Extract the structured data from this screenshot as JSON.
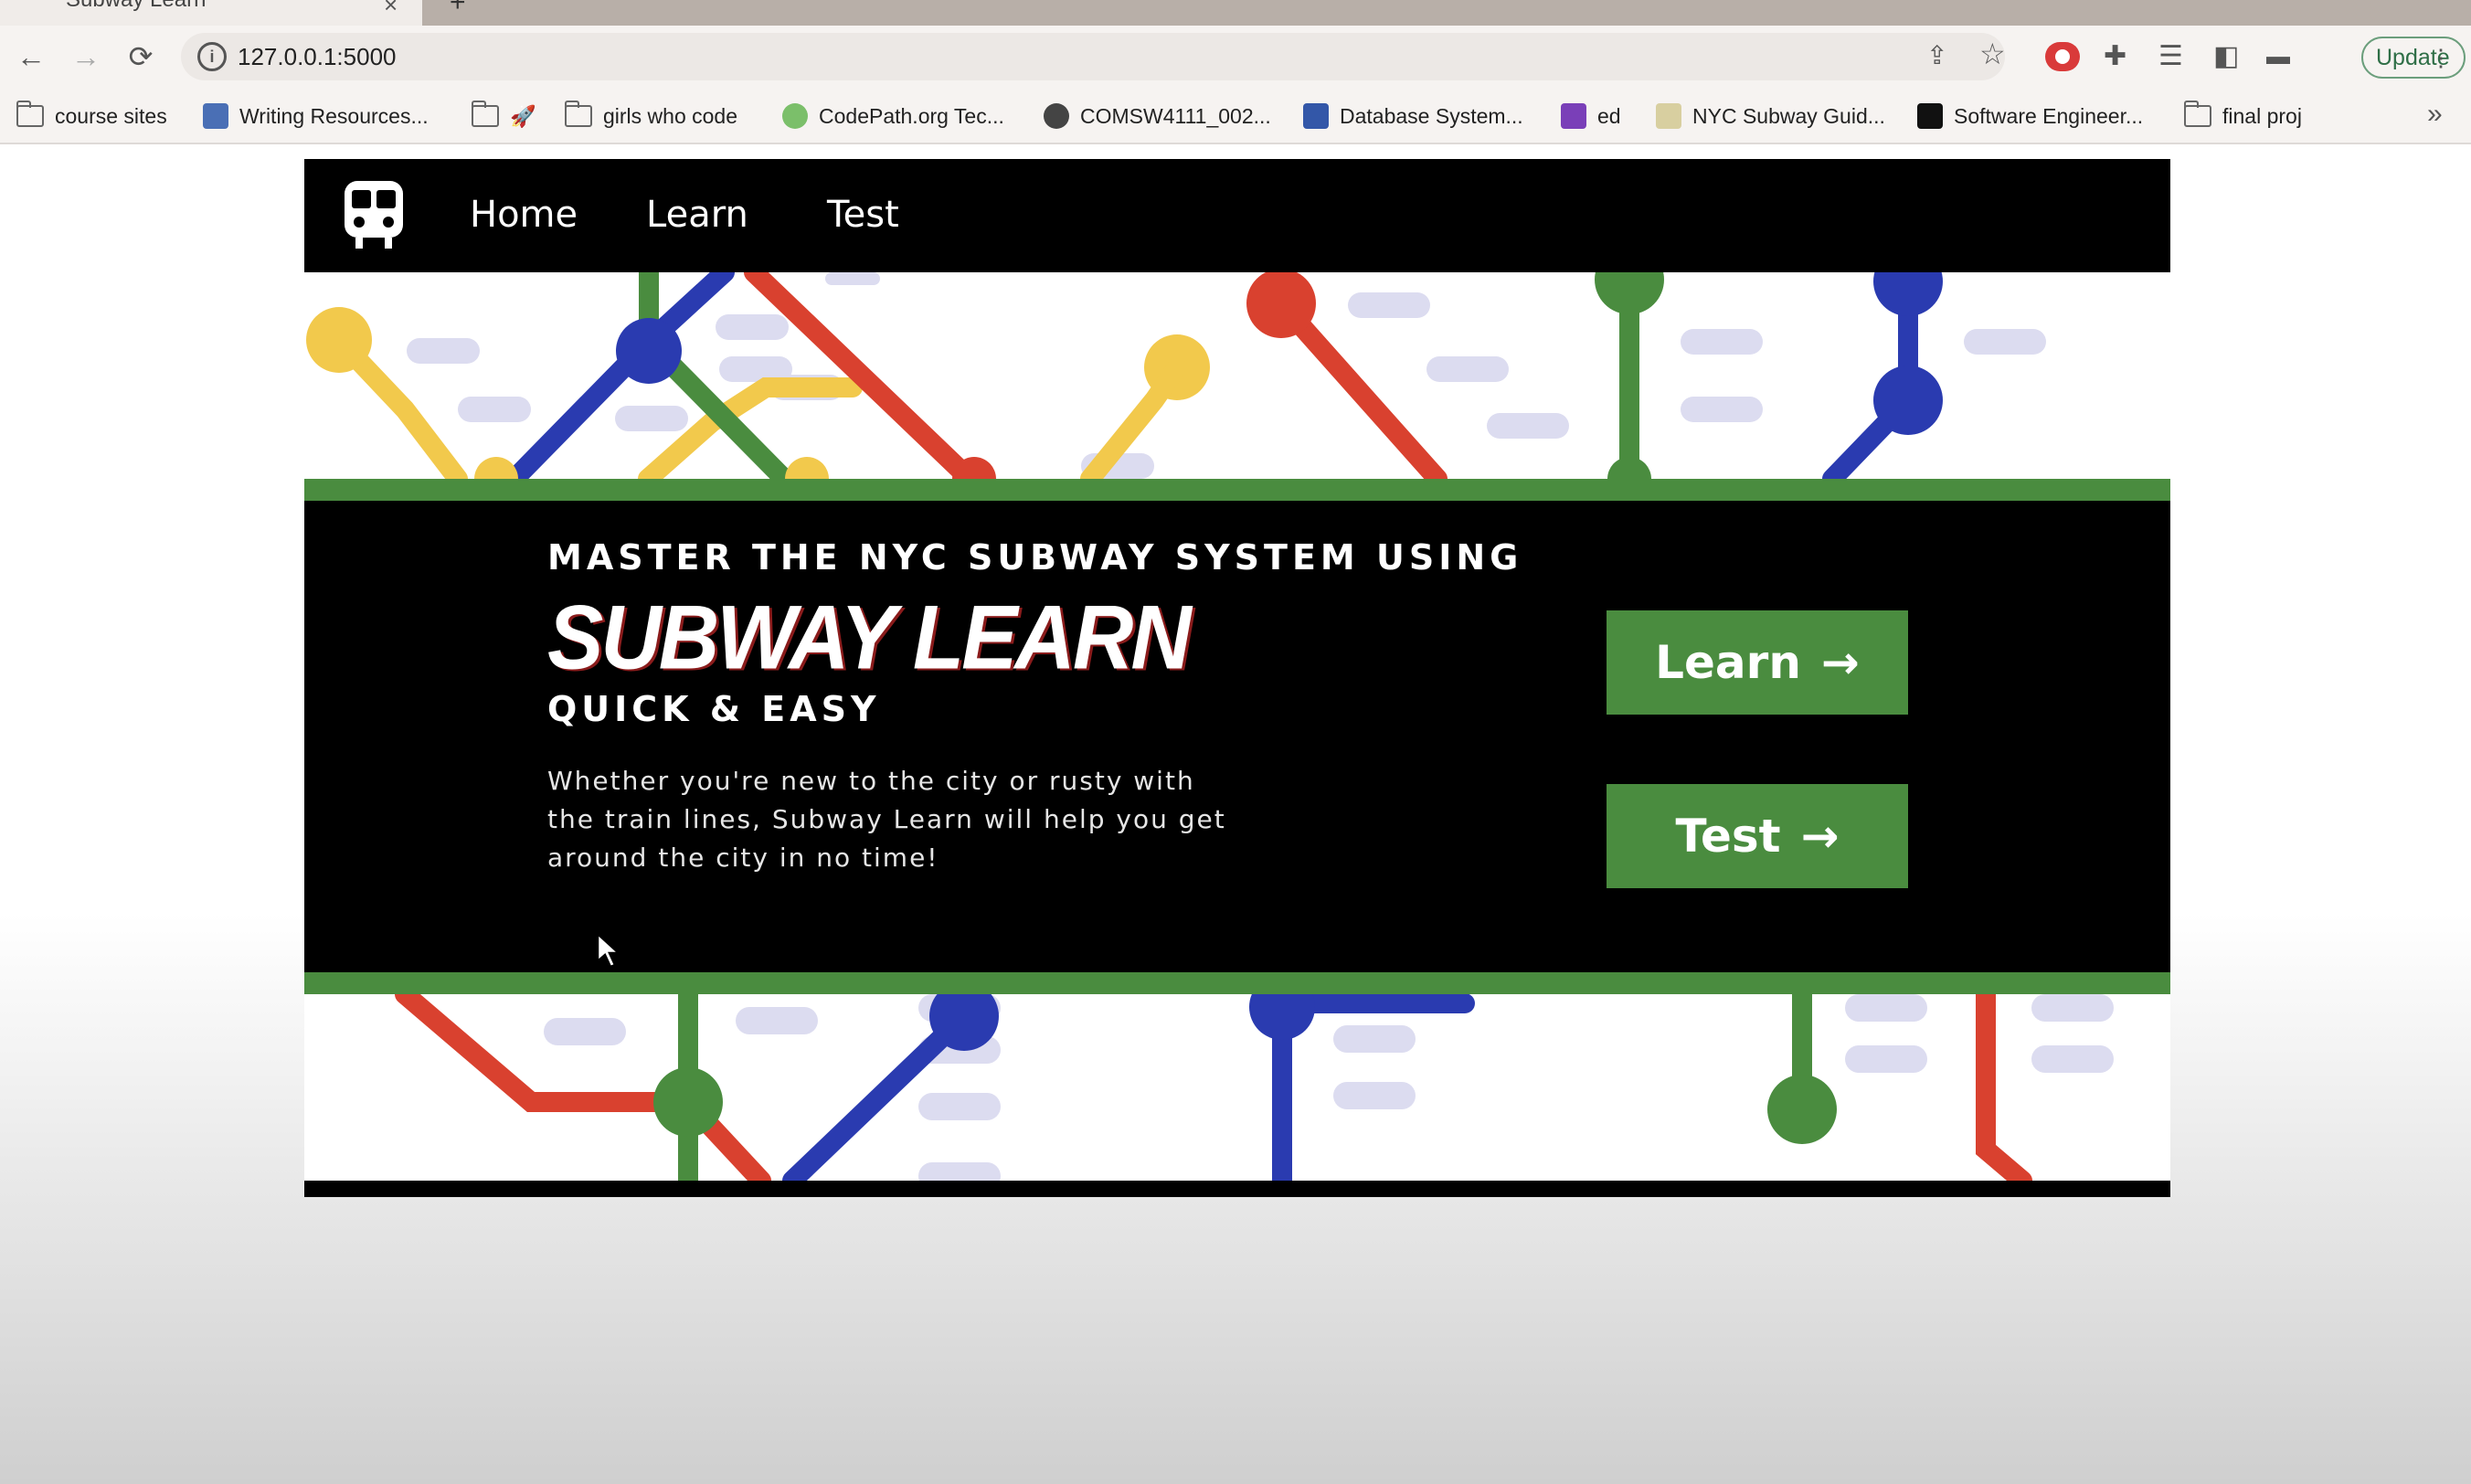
{
  "browser": {
    "tab_title": "Subway Learn",
    "tab_close": "×",
    "new_tab": "+",
    "back_icon": "←",
    "forward_icon": "→",
    "reload_icon": "⟳",
    "url": "127.0.0.1:5000",
    "update_label": "Update",
    "menu_icon": "⋮",
    "more_bookmarks": "»"
  },
  "bookmarks": [
    {
      "label": "course sites",
      "icon": "folder"
    },
    {
      "label": "Writing Resources...",
      "icon": "favicon"
    },
    {
      "label": "",
      "icon": "folder"
    },
    {
      "label": "girls who code",
      "icon": "folder"
    },
    {
      "label": "CodePath.org Tec...",
      "icon": "favicon"
    },
    {
      "label": "COMSW4111_002...",
      "icon": "favicon"
    },
    {
      "label": "Database System...",
      "icon": "favicon"
    },
    {
      "label": "ed",
      "icon": "favicon"
    },
    {
      "label": "NYC Subway Guid...",
      "icon": "favicon"
    },
    {
      "label": "Software Engineer...",
      "icon": "favicon"
    },
    {
      "label": "final proj",
      "icon": "folder"
    }
  ],
  "nav": {
    "logo": "train-icon",
    "links": [
      "Home",
      "Learn",
      "Test"
    ]
  },
  "hero": {
    "kicker": "MASTER THE NYC SUBWAY SYSTEM USING",
    "title": "SUBWAY LEARN",
    "subtitle": "QUICK & EASY",
    "description": "Whether you're new to the city or rusty with the train lines, Subway Learn will help you get around the city in no time!",
    "learn_button": "Learn",
    "test_button": "Test",
    "arrow": "→"
  },
  "colors": {
    "green": "#4a8c3f",
    "red": "#d9412f",
    "blue": "#2a3bb0",
    "yellow": "#f2c94c",
    "black": "#000000"
  }
}
